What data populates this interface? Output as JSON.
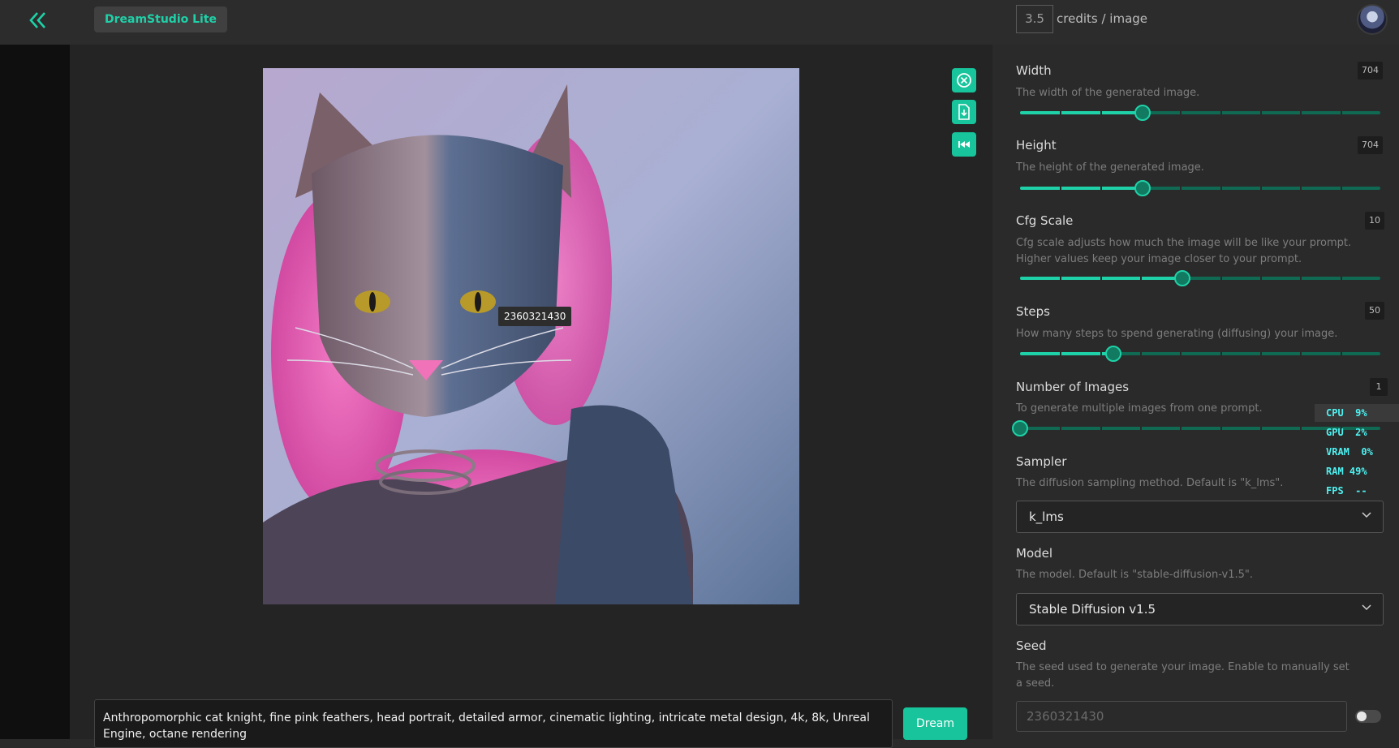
{
  "header": {
    "app_name": "DreamStudio Lite",
    "credits_value": "3.5",
    "credits_label": "credits / image"
  },
  "image": {
    "seed_tooltip": "2360321430"
  },
  "prompt": {
    "text": "Anthropomorphic cat knight, fine pink feathers, head portrait, detailed armor, cinematic lighting, intricate metal design, 4k, 8k, Unreal Engine, octane rendering",
    "dream_label": "Dream"
  },
  "settings": {
    "width": {
      "title": "Width",
      "value": "704",
      "desc": "The width of the generated image.",
      "fraction": 0.34
    },
    "height": {
      "title": "Height",
      "value": "704",
      "desc": "The height of the generated image.",
      "fraction": 0.34
    },
    "cfg": {
      "title": "Cfg Scale",
      "value": "10",
      "desc": "Cfg scale adjusts how much the image will be like your prompt. Higher values keep your image closer to your prompt.",
      "fraction": 0.45
    },
    "steps": {
      "title": "Steps",
      "value": "50",
      "desc": "How many steps to spend generating (diffusing) your image.",
      "fraction": 0.26
    },
    "num_images": {
      "title": "Number of Images",
      "value": "1",
      "desc": "To generate multiple images from one prompt.",
      "fraction": 0.0
    },
    "sampler": {
      "title": "Sampler",
      "desc": "The diffusion sampling method. Default is \"k_lms\".",
      "selected": "k_lms"
    },
    "model": {
      "title": "Model",
      "desc": "The model. Default is \"stable-diffusion-v1.5\".",
      "selected": "Stable Diffusion v1.5"
    },
    "seed": {
      "title": "Seed",
      "desc": "The seed used to generate your image. Enable to manually set a seed.",
      "placeholder": "2360321430"
    }
  },
  "perf": {
    "cpu": "CPU  9%",
    "gpu": "GPU  2%",
    "vram": "VRAM  0%",
    "ram": "RAM 49%",
    "fps": "FPS  --"
  },
  "colors": {
    "accent": "#1fd1a8",
    "accent_dark": "#0f6953",
    "perf_text": "#4ef2f2"
  }
}
